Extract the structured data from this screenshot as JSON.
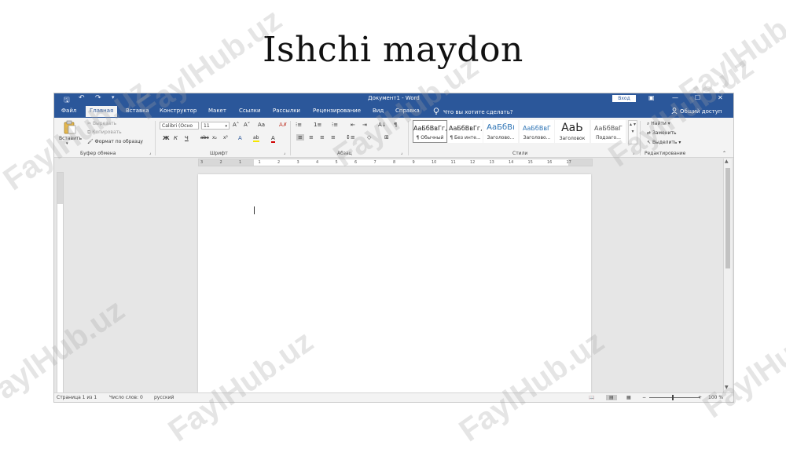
{
  "slide": {
    "title": "Ishchi maydon"
  },
  "watermarks": [
    "FaylHub.uz",
    "FaylHub.uz",
    "FaylHub.uz",
    "FaylHub.uz",
    "FaylHub.uz",
    "FaylHub.uz",
    "FaylHub.uz",
    "FaylHub.uz",
    "FaylHub.uz"
  ],
  "word": {
    "window_title": "Документ1  -  Word",
    "signin": "Вход",
    "quick_access": {
      "save": "🖫",
      "undo": "↶",
      "redo": "↷",
      "customize": "▾"
    },
    "window_controls": {
      "ribbon_display": "▣",
      "minimize": "—",
      "maximize": "☐",
      "close": "✕"
    },
    "tabs": [
      "Файл",
      "Главная",
      "Вставка",
      "Конструктор",
      "Макет",
      "Ссылки",
      "Рассылки",
      "Рецензирование",
      "Вид",
      "Справка"
    ],
    "active_tab": "Главная",
    "tell_me": "Что вы хотите сделать?",
    "share": "Общий доступ",
    "groups": {
      "clipboard": {
        "label": "Буфер обмена",
        "paste": "Вставить",
        "cut": "Вырезать",
        "copy": "Копировать",
        "format_painter": "Формат по образцу"
      },
      "font": {
        "label": "Шрифт",
        "font_name": "Calibri (Осно",
        "font_size": "11",
        "grow": "A˄",
        "shrink": "A˅",
        "change_case": "Aa",
        "clear": "A✗",
        "bold": "Ж",
        "italic": "К",
        "underline": "Ч",
        "strike": "abc",
        "subscript": "x₂",
        "superscript": "x²",
        "effects": "A",
        "highlight": "ab",
        "font_color": "A"
      },
      "paragraph": {
        "label": "Абзац",
        "bullets": "⁝≡",
        "numbering": "1≡",
        "multilevel": "⁝≡",
        "decrease_indent": "⇤",
        "increase_indent": "⇥",
        "sort": "A↓",
        "marks": "¶",
        "align_left": "≡",
        "align_center": "≡",
        "align_right": "≡",
        "justify": "≡",
        "line_spacing": "↕≡",
        "shading": "◇",
        "borders": "⊞"
      },
      "styles": {
        "label": "Стили",
        "items": [
          {
            "preview": "АаБбВвГг,",
            "name": "¶ Обычный"
          },
          {
            "preview": "АаБбВвГг,",
            "name": "¶ Без инте..."
          },
          {
            "preview": "АаБбВı",
            "name": "Заголово..."
          },
          {
            "preview": "АаБбВвГ",
            "name": "Заголово..."
          },
          {
            "preview": "АаЬ",
            "name": "Заголовок"
          },
          {
            "preview": "АаБбВвГ",
            "name": "Подзаго..."
          }
        ],
        "arrows": "▴ ▾ ▾"
      },
      "editing": {
        "label": "Редактирование",
        "find": "Найти",
        "replace": "Заменить",
        "select": "Выделить"
      },
      "collapse": "⌃"
    },
    "ruler_numbers": [
      "3",
      "2",
      "1",
      "1",
      "2",
      "3",
      "4",
      "5",
      "6",
      "7",
      "8",
      "9",
      "10",
      "11",
      "12",
      "13",
      "14",
      "15",
      "16",
      "17"
    ],
    "status": {
      "page": "Страница 1 из 1",
      "words": "Число слов: 0",
      "language": "русский",
      "zoom_minus": "−",
      "zoom_plus": "+",
      "zoom": "100 %",
      "zoom_percent": 100
    },
    "colors": {
      "title_bar": "#2b579a",
      "ribbon": "#f3f3f3",
      "canvas": "#e6e6e6",
      "page": "#ffffff"
    }
  }
}
